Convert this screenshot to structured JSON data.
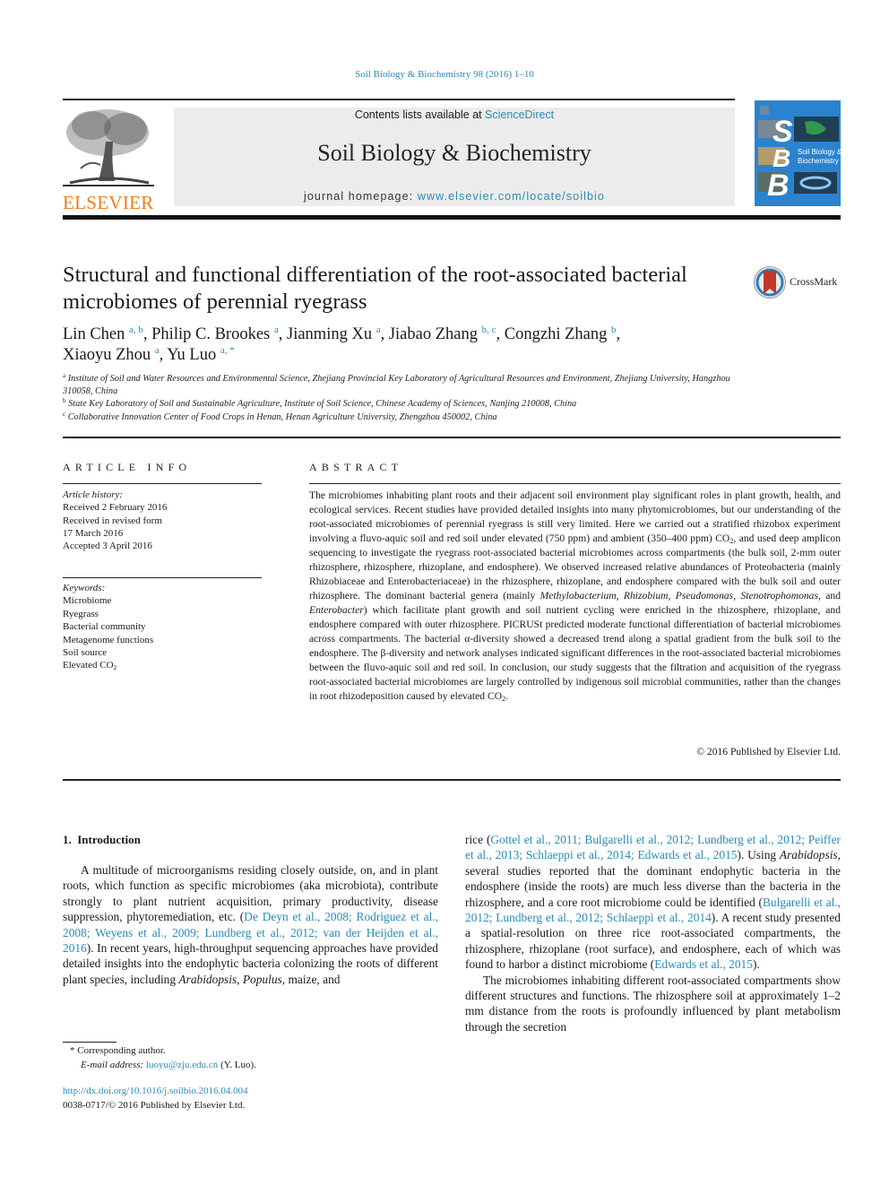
{
  "running_head": "Soil Biology & Biochemistry 98 (2016) 1–10",
  "masthead": {
    "publisher_logo_text": "ELSEVIER",
    "contents_prefix": "Contents lists available at ",
    "contents_link": "ScienceDirect",
    "journal_title": "Soil Biology & Biochemistry",
    "homepage_prefix": "journal homepage: ",
    "homepage_link": "www.elsevier.com/locate/soilbio",
    "cover_letters": [
      "S",
      "B",
      "B"
    ],
    "cover_title_line1": "Soil Biology &",
    "cover_title_line2": "Biochemistry"
  },
  "article": {
    "title": "Structural and functional differentiation of the root-associated bacterial microbiomes of perennial ryegrass",
    "crossmark_label": "CrossMark",
    "authors": [
      {
        "name": "Lin Chen",
        "aff": "a, b",
        "sep": ", "
      },
      {
        "name": "Philip C. Brookes",
        "aff": "a",
        "sep": ", "
      },
      {
        "name": "Jianming Xu",
        "aff": "a",
        "sep": ", "
      },
      {
        "name": "Jiabao Zhang",
        "aff": "b, c",
        "sep": ", "
      },
      {
        "name": "Congzhi Zhang",
        "aff": "b",
        "sep": ","
      },
      {
        "name": "Xiaoyu Zhou",
        "aff": "a",
        "sep": ", "
      },
      {
        "name": "Yu Luo",
        "aff": "a, *",
        "sep": ""
      }
    ],
    "affiliations": [
      {
        "key": "a",
        "text": "Institute of Soil and Water Resources and Environmental Science, Zhejiang Provincial Key Laboratory of Agricultural Resources and Environment, Zhejiang University, Hangzhou 310058, China"
      },
      {
        "key": "b",
        "text": "State Key Laboratory of Soil and Sustainable Agriculture, Institute of Soil Science, Chinese Academy of Sciences, Nanjing 210008, China"
      },
      {
        "key": "c",
        "text": "Collaborative Innovation Center of Food Crops in Henan, Henan Agriculture University, Zhengzhou 450002, China"
      }
    ]
  },
  "article_info": {
    "heading": "ARTICLE INFO",
    "history_label": "Article history:",
    "history": [
      "Received 2 February 2016",
      "Received in revised form",
      "17 March 2016",
      "Accepted 3 April 2016"
    ],
    "keywords_label": "Keywords:",
    "keywords": [
      "Microbiome",
      "Ryegrass",
      "Bacterial community",
      "Metagenome functions",
      "Soil source"
    ],
    "keyword_last_prefix": "Elevated CO",
    "keyword_last_sub": "2"
  },
  "abstract": {
    "heading": "ABSTRACT",
    "p1": "The microbiomes inhabiting plant roots and their adjacent soil environment play significant roles in plant growth, health, and ecological services. Recent studies have provided detailed insights into many phytomicrobiomes, but our understanding of the root-associated microbiomes of perennial ryegrass is still very limited. Here we carried out a stratified rhizobox experiment involving a fluvo-aquic soil and red soil under elevated (750 ppm) and ambient (350–400 ppm) CO",
    "p2": ", and used deep amplicon sequencing to investigate the ryegrass root-associated bacterial microbiomes across compartments (the bulk soil, 2-mm outer rhizosphere, rhizosphere, rhizoplane, and endosphere). We observed increased relative abundances of Proteobacteria (mainly Rhizobiaceae and Enterobacteriaceae) in the rhizosphere, rhizoplane, and endosphere compared with the bulk soil and outer rhizosphere. The dominant bacterial genera (mainly ",
    "genera": [
      "Methylobacterium",
      "Rhizobium",
      "Pseudomonas",
      "Stenotrophomonas",
      "Enterobacter"
    ],
    "p3": ") which facilitate plant growth and soil nutrient cycling were enriched in the rhizosphere, rhizoplane, and endosphere compared with outer rhizosphere. PICRUSt predicted moderate functional differentiation of bacterial microbiomes across compartments. The bacterial α-diversity showed a decreased trend along a spatial gradient from the bulk soil to the endosphere. The β-diversity and network analyses indicated significant differences in the root-associated bacterial microbiomes between the fluvo-aquic soil and red soil. In conclusion, our study suggests that the filtration and acquisition of the ryegrass root-associated bacterial microbiomes are largely controlled by indigenous soil microbial communities, rather than the changes in root rhizodeposition caused by elevated CO",
    "end": ".",
    "copyright": "© 2016 Published by Elsevier Ltd."
  },
  "introduction": {
    "heading": "1. Introduction",
    "left_a": "A multitude of microorganisms residing closely outside, on, and in plant roots, which function as specific microbiomes (aka microbiota), contribute strongly to plant nutrient acquisition, primary productivity, disease suppression, phytoremediation, etc. (",
    "left_cite": "De Deyn et al., 2008; Rodriguez et al., 2008; Weyens et al., 2009; Lundberg et al., 2012; van der Heijden et al., 2016",
    "left_b": "). In recent years, high-throughput sequencing approaches have provided detailed insights into the endophytic bacteria colonizing the roots of different plant species, including ",
    "left_it1": "Arabidopsis",
    "left_it2": "Populus",
    "left_c": ", maize, and",
    "right_a": "rice (",
    "right_cite1": "Gottel et al., 2011; Bulgarelli et al., 2012; Lundberg et al., 2012; Peiffer et al., 2013; Schlaeppi et al., 2014; Edwards et al., 2015",
    "right_b": "). Using ",
    "right_it": "Arabidopsis",
    "right_c": ", several studies reported that the dominant endophytic bacteria in the endosphere (inside the roots) are much less diverse than the bacteria in the rhizosphere, and a core root microbiome could be identified (",
    "right_cite2": "Bulgarelli et al., 2012; Lundberg et al., 2012; Schlaeppi et al., 2014",
    "right_d": "). A recent study presented a spatial-resolution on three rice root-associated compartments, the rhizosphere, rhizoplane (root surface), and endosphere, each of which was found to harbor a distinct microbiome (",
    "right_cite3": "Edwards et al., 2015",
    "right_e": ").",
    "right_p2": "The microbiomes inhabiting different root-associated compartments show different structures and functions. The rhizosphere soil at approximately 1–2 mm distance from the roots is profoundly influenced by plant metabolism through the secretion"
  },
  "footnotes": {
    "corresponding": "* Corresponding author.",
    "email_label": "E-mail address: ",
    "email": "luoyu@zju.edu.cn",
    "email_suffix": " (Y. Luo).",
    "doi": "http://dx.doi.org/10.1016/j.soilbio.2016.04.004",
    "issn_line": "0038-0717/© 2016 Published by Elsevier Ltd."
  },
  "colors": {
    "link": "#2a8ab8",
    "elsevier_orange": "#ef7d1f",
    "cover_blue": "#2b83cf",
    "crossmark_red": "#c0392b"
  }
}
